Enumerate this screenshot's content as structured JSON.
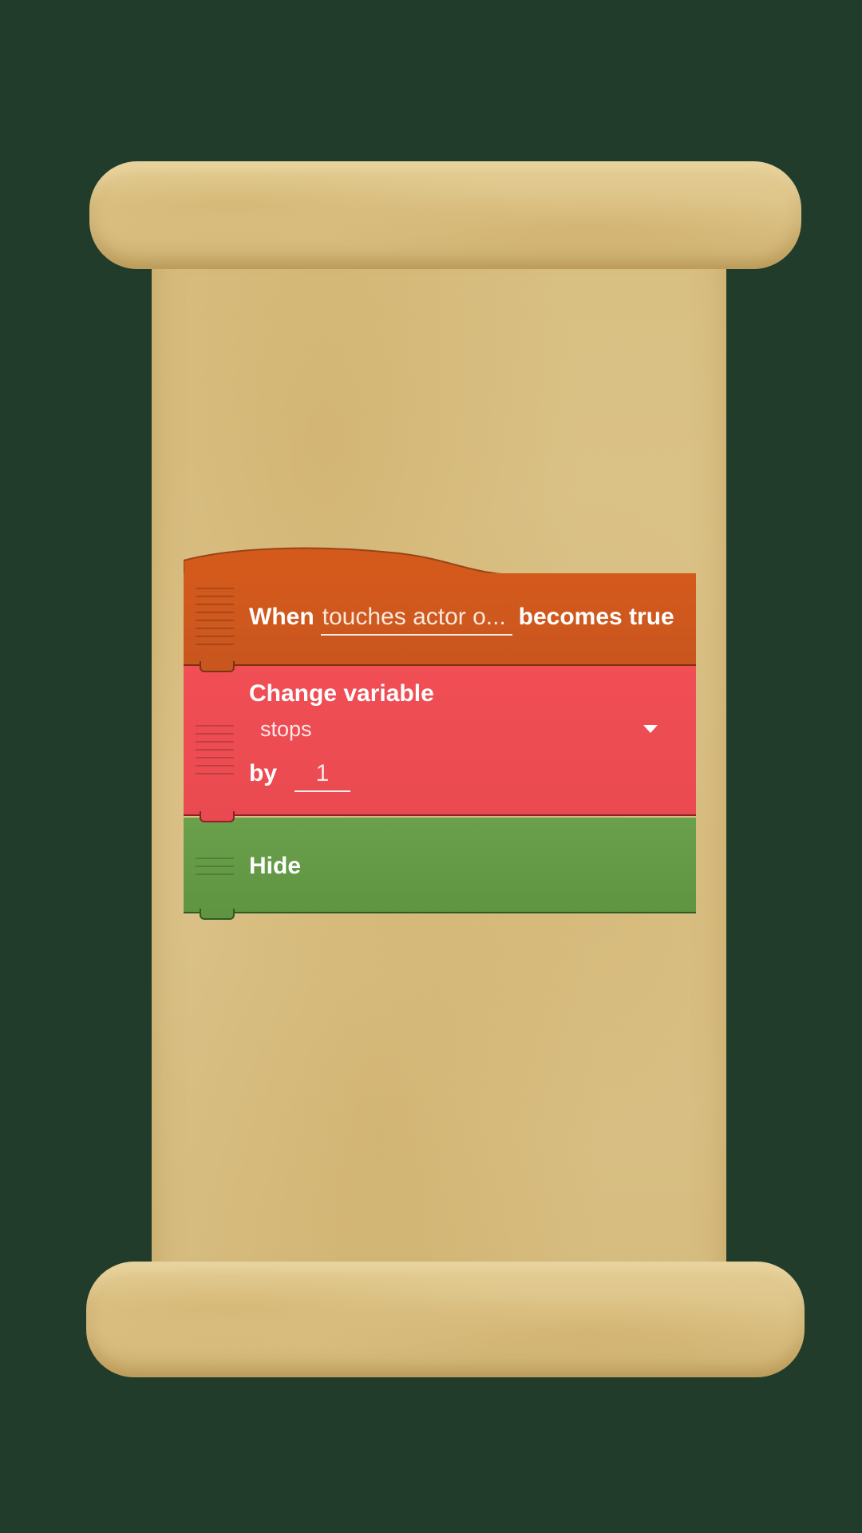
{
  "event_block": {
    "when_label": "When",
    "field_value": "touches actor o...",
    "suffix_label": "becomes true",
    "color": "#d45a1c"
  },
  "change_block": {
    "title": "Change variable",
    "variable_value": "stops",
    "by_label": "by",
    "amount_value": "1",
    "color": "#f14e55"
  },
  "hide_block": {
    "label": "Hide",
    "color": "#6aa04b"
  },
  "background_color": "#223c2b",
  "parchment_color": "#dcc389"
}
